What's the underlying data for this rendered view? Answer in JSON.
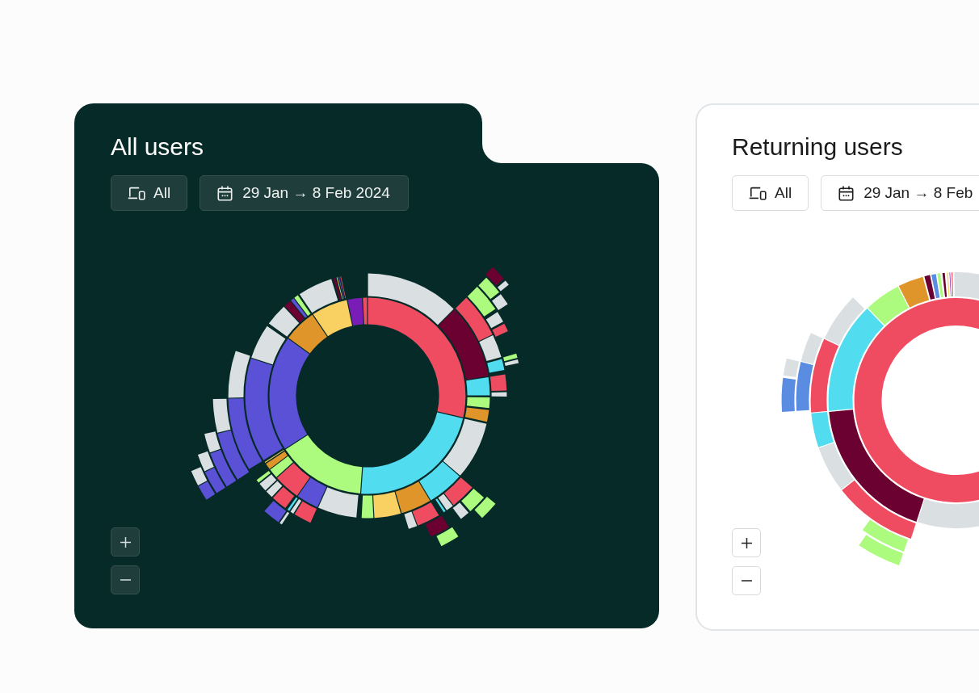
{
  "cards": [
    {
      "kind": "dark",
      "title": "All users",
      "filters": [
        {
          "kind": "device",
          "label": "All"
        },
        {
          "kind": "date",
          "label": "29 Jan → 8 Feb 2024"
        }
      ]
    },
    {
      "kind": "light",
      "title": "Returning users",
      "filters": [
        {
          "kind": "device",
          "label": "All"
        },
        {
          "kind": "date",
          "label": "29 Jan → 8 Feb"
        }
      ]
    }
  ]
}
